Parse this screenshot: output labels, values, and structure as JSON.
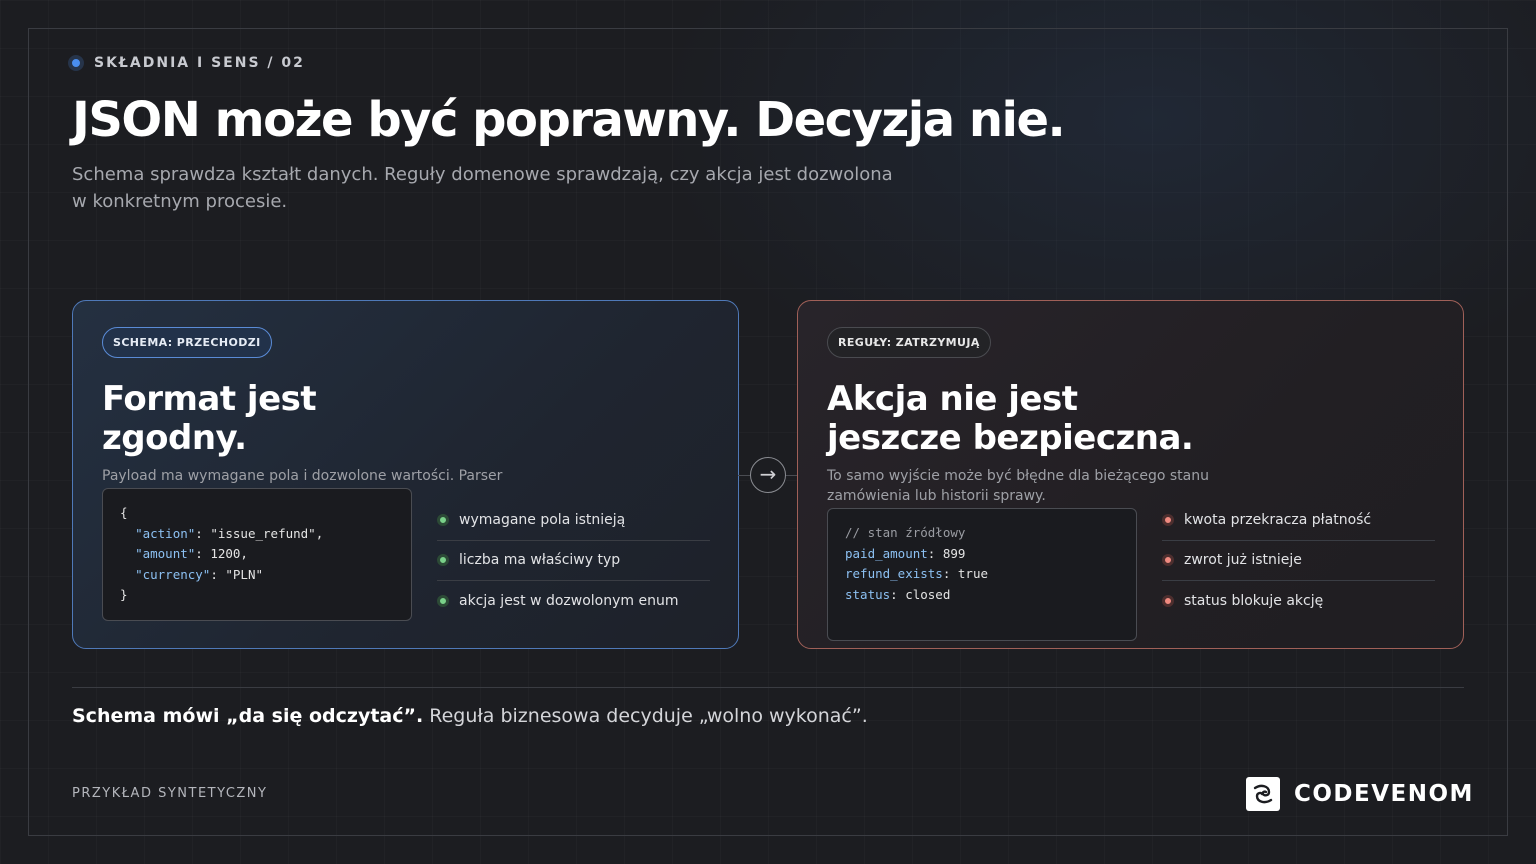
{
  "header": {
    "eyebrow": "SKŁADNIA I SENS / 02",
    "title": "JSON może być poprawny. Decyzja nie.",
    "subtitle_line1": "Schema sprawdza kształt danych. Reguły domenowe sprawdzają, czy akcja jest dozwolona",
    "subtitle_line2": "w konkretnym procesie."
  },
  "left_card": {
    "badge": "SCHEMA: PRZECHODZI",
    "title_line1": "Format jest",
    "title_line2": "zgodny.",
    "description": "Payload ma wymagane pola i dozwolone wartości. Parser",
    "code": {
      "open": "{",
      "l1_key": "\"action\"",
      "l1_val": ": \"issue_refund\",",
      "l2_key": "\"amount\"",
      "l2_val": ": 1200,",
      "l3_key": "\"currency\"",
      "l3_val": ": \"PLN\"",
      "close": "}"
    },
    "checks": [
      "wymagane pola istnieją",
      "liczba ma właściwy typ",
      "akcja jest w dozwolonym enum"
    ],
    "check_color": "#7ad18a"
  },
  "arrow": "→",
  "right_card": {
    "badge": "REGUŁY: ZATRZYMUJĄ",
    "title_line1": "Akcja nie jest",
    "title_line2": "jeszcze bezpieczna.",
    "description_line1": "To samo wyjście może być błędne dla bieżącego stanu",
    "description_line2": "zamówienia lub historii sprawy.",
    "code": {
      "comment": "// stan źródłowy",
      "l1_key": "paid_amount",
      "l1_val": ": 899",
      "l2_key": "refund_exists",
      "l2_val": ": true",
      "l3_key": "status",
      "l3_val": ": closed"
    },
    "checks": [
      "kwota przekracza płatność",
      "zwrot już istnieje",
      "status blokuje akcję"
    ],
    "check_color": "#f08a80"
  },
  "summary": {
    "bold": "Schema mówi „da się odczytać”.",
    "rest": " Reguła biznesowa decyduje „wolno wykonać”."
  },
  "footer": {
    "note": "PRZYKŁAD SYNTETYCZNY",
    "brand": "CODEVENOM"
  },
  "colors": {
    "accent_blue": "#4a8ef0",
    "left_border": "#4f79b8",
    "right_border": "#a06058"
  }
}
